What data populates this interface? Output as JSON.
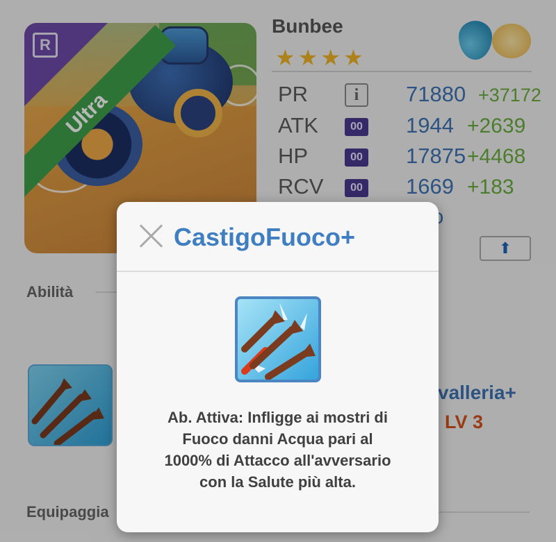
{
  "monster": {
    "name": "Bunbee",
    "stars": "★★★★",
    "rarity_badge": "R",
    "ribbon": "Ultra"
  },
  "stats": [
    {
      "label": "PR",
      "icon": "i",
      "value": "71880",
      "bonus": "+37172"
    },
    {
      "label": "ATK",
      "icon": "00",
      "value": "1944",
      "bonus": "+2639"
    },
    {
      "label": "HP",
      "icon": "00",
      "value": "17875",
      "bonus": "+4468"
    },
    {
      "label": "RCV",
      "icon": "00",
      "value": "1669",
      "bonus": "+183"
    }
  ],
  "level_text": "ssimo",
  "upgrade_icon": "⬆",
  "sections": {
    "abilities": "Abilità",
    "equipment": "Equipaggia"
  },
  "skill": {
    "name": "valleria+",
    "level": "LV 3"
  },
  "modal": {
    "title": "CastigoFuoco+",
    "description_lines": [
      "Ab. Attiva: Infligge ai mostri di",
      "Fuoco danni Acqua pari al",
      "1000% di Attacco all'avversario",
      "con la Salute più alta."
    ]
  },
  "colors": {
    "accent_blue": "#3e74b5",
    "bonus_green": "#6aad3e",
    "level_orange": "#d4531c",
    "star_gold": "#f0b429"
  }
}
